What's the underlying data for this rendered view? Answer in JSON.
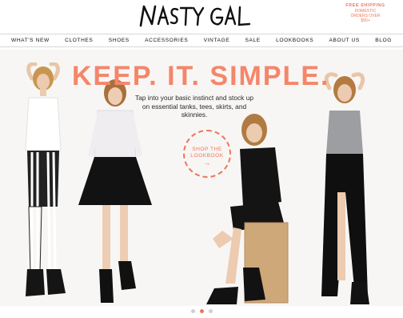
{
  "brand": {
    "logo_text": "NASTY GAL",
    "accent_color": "#f0745a"
  },
  "free_shipping": {
    "arc_text": "FREE SHIPPING",
    "line1": "DOMESTIC",
    "line2": "ORDERS OVER",
    "line3": "$50+"
  },
  "nav": {
    "items": [
      {
        "label": "WHAT'S NEW"
      },
      {
        "label": "CLOTHES"
      },
      {
        "label": "SHOES"
      },
      {
        "label": "ACCESSORIES"
      },
      {
        "label": "VINTAGE"
      },
      {
        "label": "SALE"
      },
      {
        "label": "LOOKBOOKS"
      },
      {
        "label": "ABOUT US"
      },
      {
        "label": "BLOG"
      }
    ]
  },
  "hero": {
    "headline": "KEEP. IT. SIMPLE.",
    "tagline": "Tap into your basic instinct and stock up on essential tanks, tees, skirts, and skinnies.",
    "cta": {
      "label": "SHOP THE LOOKBOOK",
      "arrow": "→"
    }
  },
  "carousel": {
    "slides": 3,
    "active_index": 1
  }
}
